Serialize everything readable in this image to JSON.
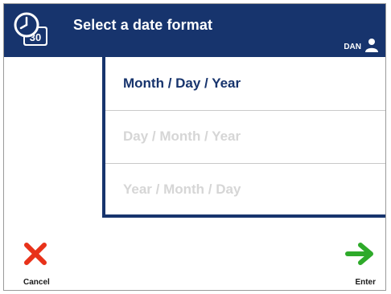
{
  "header": {
    "title": "Select a date format",
    "calendar_day": "30",
    "user": "DAN",
    "background": "#17346d"
  },
  "options": [
    {
      "label": "Month / Day / Year",
      "state": "selected"
    },
    {
      "label": "Day / Month / Year",
      "state": "dimmed"
    },
    {
      "label": "Year / Month / Day",
      "state": "dimmed"
    }
  ],
  "actions": {
    "cancel_label": "Cancel",
    "cancel_icon": "x-icon",
    "cancel_color": "#e8321a",
    "enter_label": "Enter",
    "enter_icon": "arrow-right-icon",
    "enter_color": "#2eaa2a"
  },
  "colors": {
    "accent": "#17346d",
    "dimmed_text": "#d6d6d6",
    "divider": "#c9c9c9"
  }
}
